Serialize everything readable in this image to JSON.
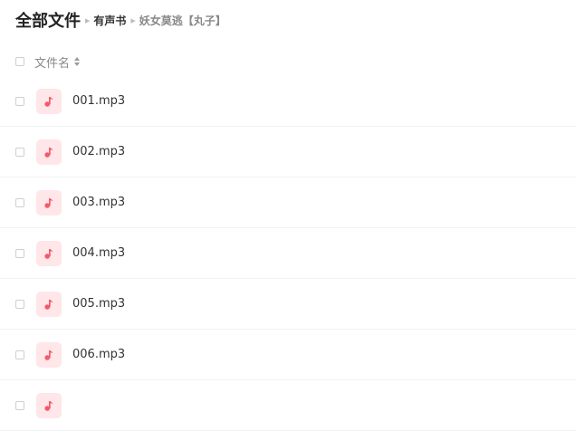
{
  "breadcrumb": {
    "root": "全部文件",
    "items": [
      "有声书",
      "妖女莫逃【丸子】"
    ]
  },
  "columns": {
    "name": "文件名"
  },
  "files": [
    {
      "name": "001.mp3",
      "icon": "music-note-icon"
    },
    {
      "name": "002.mp3",
      "icon": "music-note-icon"
    },
    {
      "name": "003.mp3",
      "icon": "music-note-icon"
    },
    {
      "name": "004.mp3",
      "icon": "music-note-icon"
    },
    {
      "name": "005.mp3",
      "icon": "music-note-icon"
    },
    {
      "name": "006.mp3",
      "icon": "music-note-icon"
    },
    {
      "name": "",
      "icon": "music-note-icon"
    }
  ],
  "colors": {
    "icon_bg": "#ffe6e8",
    "icon_fg": "#f35b6a"
  }
}
